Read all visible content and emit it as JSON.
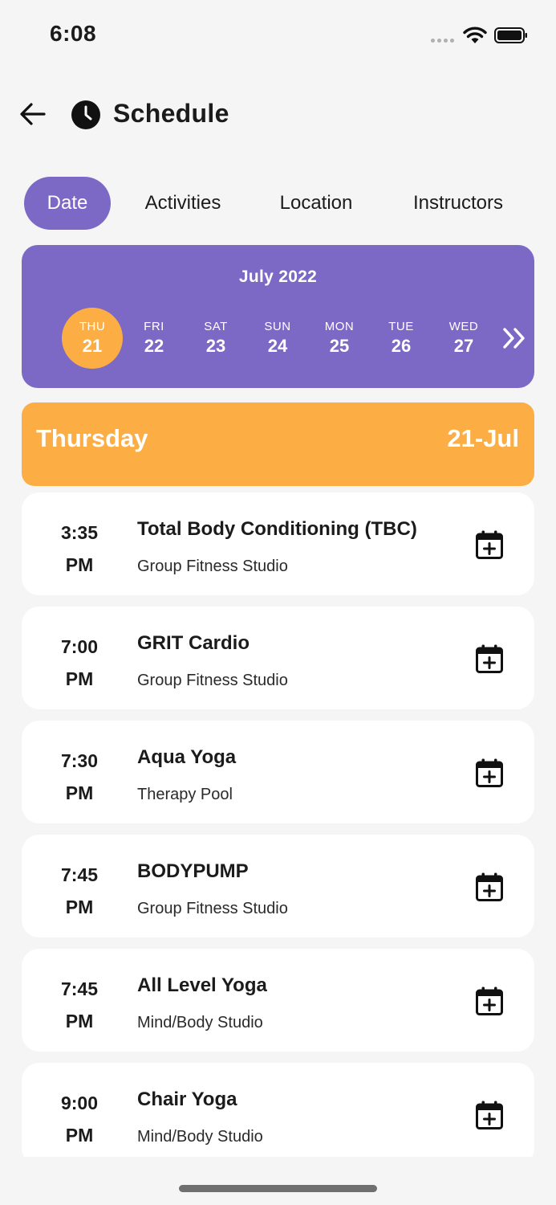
{
  "status_bar": {
    "time": "6:08"
  },
  "header": {
    "title": "Schedule"
  },
  "tabs": [
    {
      "label": "Date",
      "active": true
    },
    {
      "label": "Activities",
      "active": false
    },
    {
      "label": "Location",
      "active": false
    },
    {
      "label": "Instructors",
      "active": false
    }
  ],
  "calendar": {
    "month": "July 2022",
    "days": [
      {
        "dow": "THU",
        "num": "21",
        "selected": true
      },
      {
        "dow": "FRI",
        "num": "22",
        "selected": false
      },
      {
        "dow": "SAT",
        "num": "23",
        "selected": false
      },
      {
        "dow": "SUN",
        "num": "24",
        "selected": false
      },
      {
        "dow": "MON",
        "num": "25",
        "selected": false
      },
      {
        "dow": "TUE",
        "num": "26",
        "selected": false
      },
      {
        "dow": "WED",
        "num": "27",
        "selected": false
      }
    ]
  },
  "day_header": {
    "name": "Thursday",
    "date": "21-Jul"
  },
  "classes": [
    {
      "time": "3:35",
      "ampm": "PM",
      "name": "Total Body Conditioning (TBC)",
      "location": "Group Fitness Studio"
    },
    {
      "time": "7:00",
      "ampm": "PM",
      "name": "GRIT Cardio",
      "location": "Group Fitness Studio"
    },
    {
      "time": "7:30",
      "ampm": "PM",
      "name": "Aqua Yoga",
      "location": "Therapy Pool"
    },
    {
      "time": "7:45",
      "ampm": "PM",
      "name": "BODYPUMP",
      "location": "Group Fitness Studio"
    },
    {
      "time": "7:45",
      "ampm": "PM",
      "name": "All Level Yoga",
      "location": "Mind/Body Studio"
    },
    {
      "time": "9:00",
      "ampm": "PM",
      "name": "Chair Yoga",
      "location": "Mind/Body Studio"
    }
  ],
  "colors": {
    "accent_purple": "#7b69c5",
    "accent_orange": "#fcae45",
    "background": "#f5f5f5"
  },
  "icons": {
    "back": "arrow-left-icon",
    "title": "clock-icon",
    "next_week": "double-chevron-right-icon",
    "add_to_calendar": "calendar-plus-icon"
  }
}
